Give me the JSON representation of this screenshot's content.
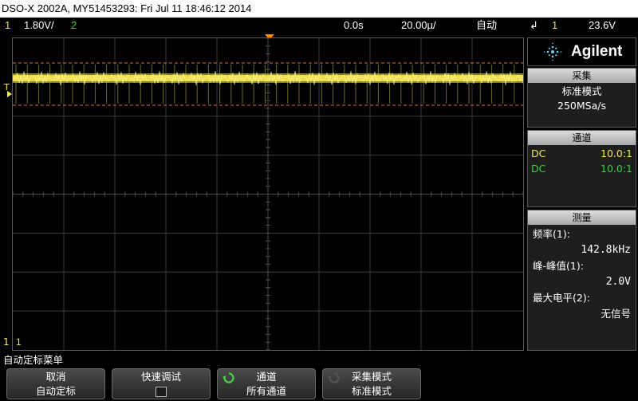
{
  "titlebar": {
    "text": "DSO-X 2002A, MY51453293: Fri Jul 11 18:46:12 2014"
  },
  "status": {
    "ch1_num": "1",
    "ch1_scale": "1.80V/",
    "ch2_num": "2",
    "time_offset": "0.0s",
    "time_scale": "20.00µ/",
    "trig_mode": "自动",
    "trig_icon": "↲",
    "trig_source": "1",
    "trig_level": "23.6V"
  },
  "markers": {
    "ch1": "T",
    "ground": "1",
    "ground2": "1"
  },
  "logo": {
    "text": "Agilent",
    "icon": "agilent-spark-icon"
  },
  "acquire": {
    "header": "采集",
    "mode": "标准模式",
    "rate": "250MSa/s"
  },
  "channels": {
    "header": "通道",
    "rows": [
      {
        "coupling": "DC",
        "probe": "10.0:1",
        "color": "#f5e84a"
      },
      {
        "coupling": "DC",
        "probe": "10.0:1",
        "color": "#35d63c"
      }
    ]
  },
  "measure": {
    "header": "测量",
    "items": [
      {
        "label": "频率(1):",
        "value": "142.8kHz"
      },
      {
        "label": "峰-峰值(1):",
        "value": "2.0V"
      },
      {
        "label": "最大电平(2):",
        "value": "无信号"
      }
    ]
  },
  "menu": {
    "title": "自动定标菜单",
    "softkeys": [
      {
        "line1": "取消",
        "line2": "自动定标"
      },
      {
        "line1": "快速调试",
        "line2": ""
      },
      {
        "line1": "通道",
        "line2": "所有通道"
      },
      {
        "line1": "采集模式",
        "line2": "标准模式"
      }
    ]
  },
  "colors": {
    "ch1": "#f5e84a",
    "ch2": "#35d63c",
    "trigger": "#ff8a00",
    "cursor": "#e0703c"
  }
}
